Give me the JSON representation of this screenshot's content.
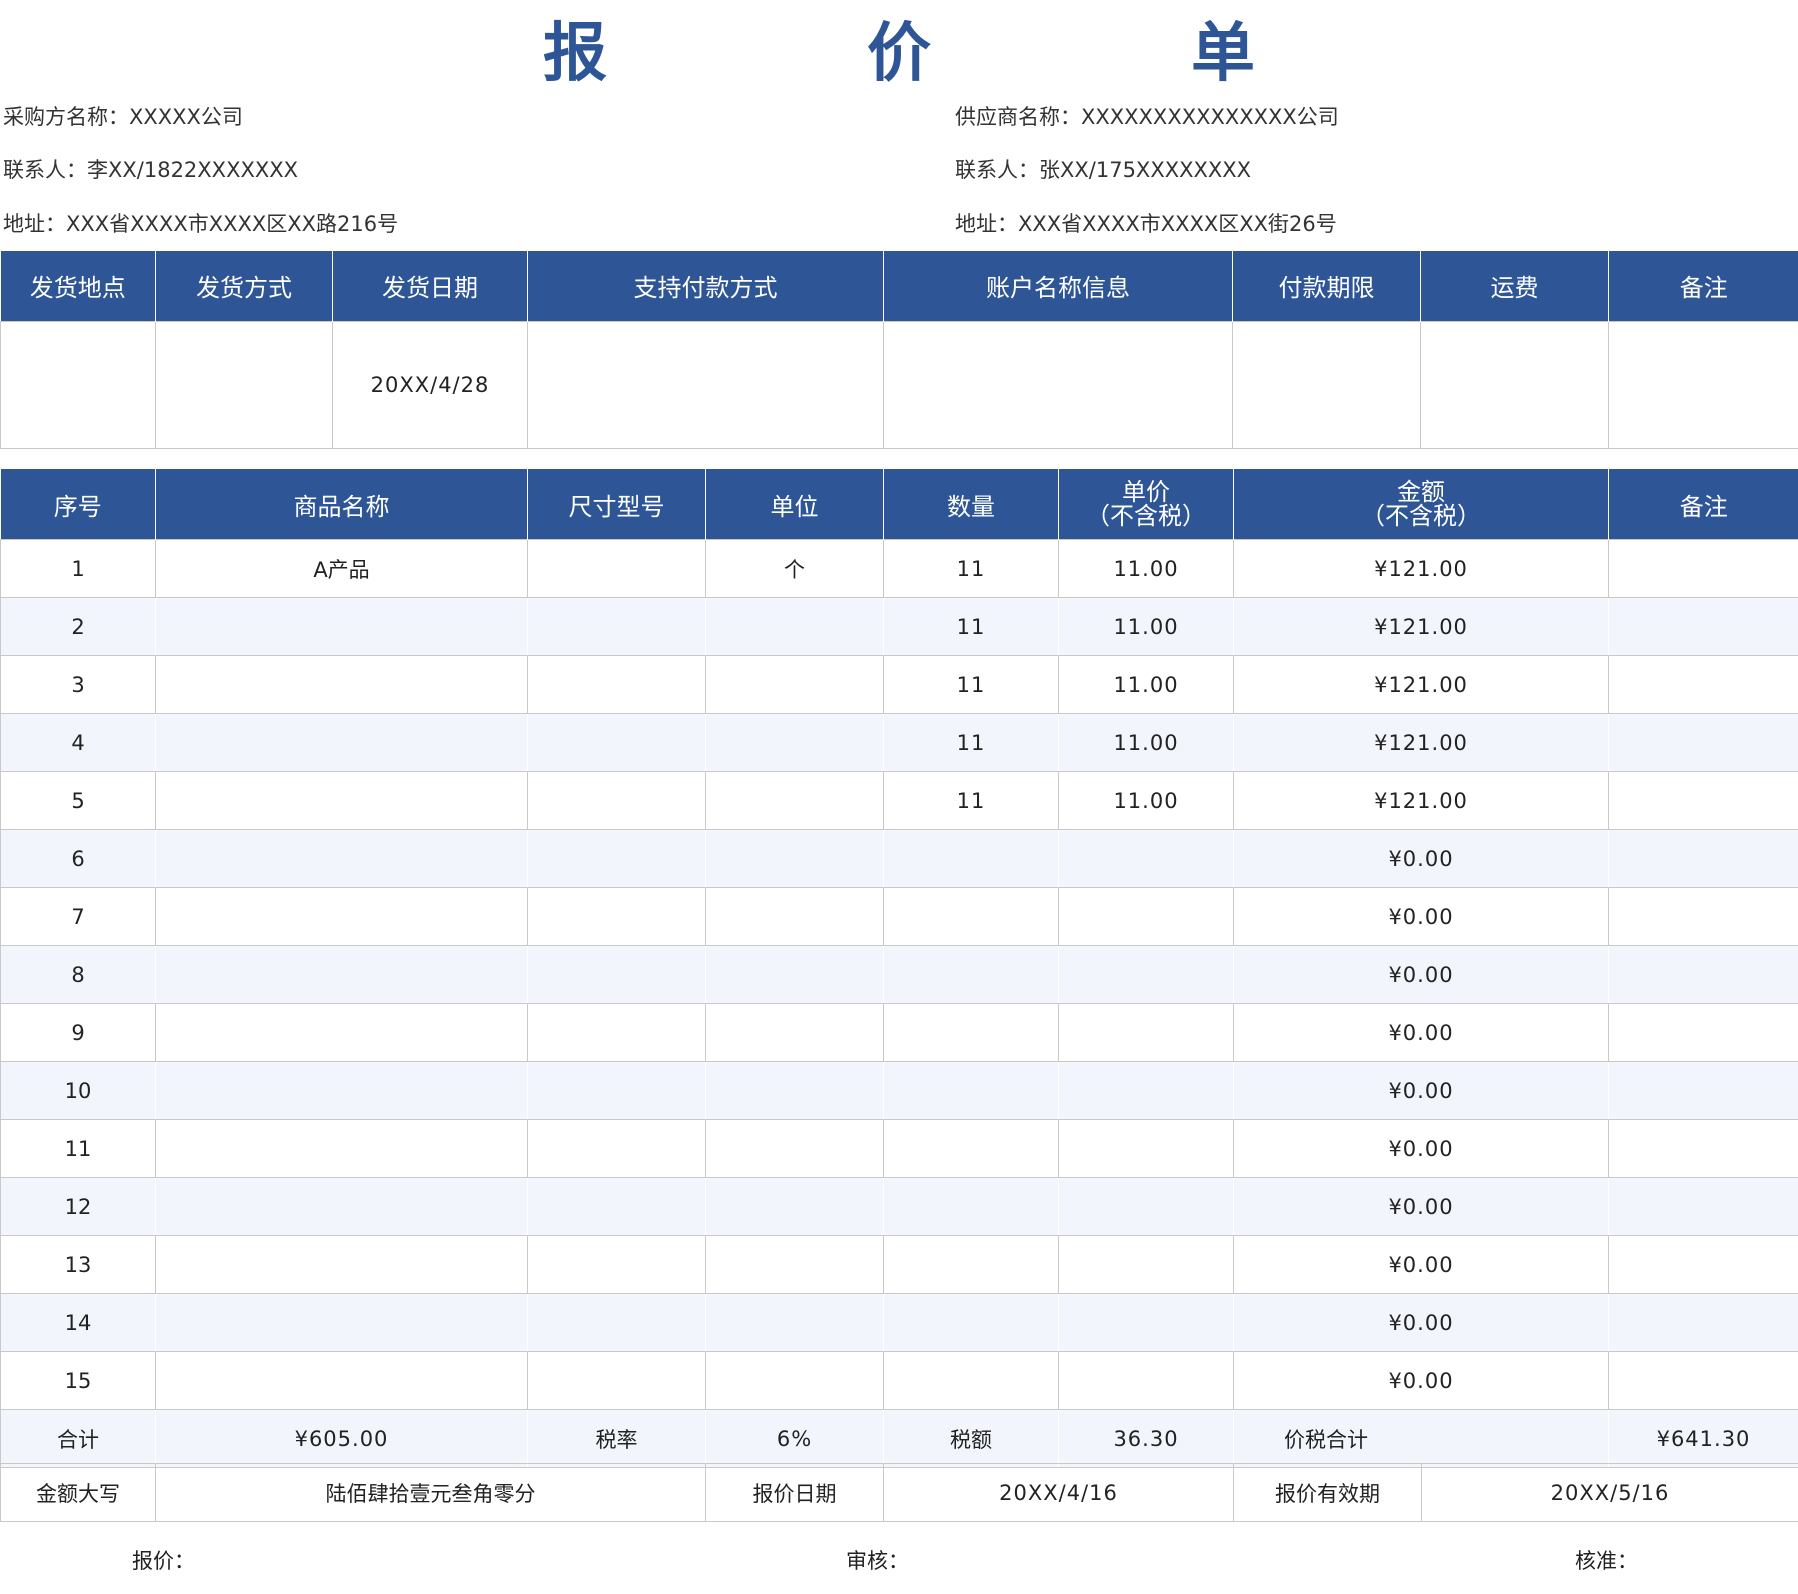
{
  "title": [
    "报",
    "价",
    "单"
  ],
  "buyer": {
    "name": "采购方名称：XXXXX公司",
    "contact": "联系人：李XX/1822XXXXXXX",
    "address": "地址：XXX省XXXX市XXXX区XX路216号"
  },
  "supplier": {
    "name": "供应商名称：XXXXXXXXXXXXXXX公司",
    "contact": "联系人：张XX/175XXXXXXXX",
    "address": "地址：XXX省XXXX市XXXX区XX街26号"
  },
  "shipping": {
    "headers": [
      "发货地点",
      "发货方式",
      "发货日期",
      "支持付款方式",
      "账户名称信息",
      "付款期限",
      "运费",
      "备注"
    ],
    "values": [
      "",
      "",
      "20XX/4/28",
      "",
      "",
      "",
      "",
      ""
    ]
  },
  "items": {
    "headers": [
      "序号",
      "商品名称",
      "尺寸型号",
      "单位",
      "数量",
      "单价\n（不含税）",
      "金额\n（不含税）",
      "备注"
    ],
    "header_unit_price": [
      "单价",
      "（不含税）"
    ],
    "header_amount": [
      "金额",
      "（不含税）"
    ],
    "rows": [
      {
        "no": "1",
        "name": "A产品",
        "size": "",
        "unit": "个",
        "qty": "11",
        "price": "11.00",
        "amount": "¥121.00",
        "note": ""
      },
      {
        "no": "2",
        "name": "",
        "size": "",
        "unit": "",
        "qty": "11",
        "price": "11.00",
        "amount": "¥121.00",
        "note": ""
      },
      {
        "no": "3",
        "name": "",
        "size": "",
        "unit": "",
        "qty": "11",
        "price": "11.00",
        "amount": "¥121.00",
        "note": ""
      },
      {
        "no": "4",
        "name": "",
        "size": "",
        "unit": "",
        "qty": "11",
        "price": "11.00",
        "amount": "¥121.00",
        "note": ""
      },
      {
        "no": "5",
        "name": "",
        "size": "",
        "unit": "",
        "qty": "11",
        "price": "11.00",
        "amount": "¥121.00",
        "note": ""
      },
      {
        "no": "6",
        "name": "",
        "size": "",
        "unit": "",
        "qty": "",
        "price": "",
        "amount": "¥0.00",
        "note": ""
      },
      {
        "no": "7",
        "name": "",
        "size": "",
        "unit": "",
        "qty": "",
        "price": "",
        "amount": "¥0.00",
        "note": ""
      },
      {
        "no": "8",
        "name": "",
        "size": "",
        "unit": "",
        "qty": "",
        "price": "",
        "amount": "¥0.00",
        "note": ""
      },
      {
        "no": "9",
        "name": "",
        "size": "",
        "unit": "",
        "qty": "",
        "price": "",
        "amount": "¥0.00",
        "note": ""
      },
      {
        "no": "10",
        "name": "",
        "size": "",
        "unit": "",
        "qty": "",
        "price": "",
        "amount": "¥0.00",
        "note": ""
      },
      {
        "no": "11",
        "name": "",
        "size": "",
        "unit": "",
        "qty": "",
        "price": "",
        "amount": "¥0.00",
        "note": ""
      },
      {
        "no": "12",
        "name": "",
        "size": "",
        "unit": "",
        "qty": "",
        "price": "",
        "amount": "¥0.00",
        "note": ""
      },
      {
        "no": "13",
        "name": "",
        "size": "",
        "unit": "",
        "qty": "",
        "price": "",
        "amount": "¥0.00",
        "note": ""
      },
      {
        "no": "14",
        "name": "",
        "size": "",
        "unit": "",
        "qty": "",
        "price": "",
        "amount": "¥0.00",
        "note": ""
      },
      {
        "no": "15",
        "name": "",
        "size": "",
        "unit": "",
        "qty": "",
        "price": "",
        "amount": "¥0.00",
        "note": ""
      }
    ]
  },
  "totals": {
    "subtotal_label": "合计",
    "subtotal_value": "¥605.00",
    "tax_rate_label": "税率",
    "tax_rate_value": "6%",
    "tax_amount_label": "税额",
    "tax_amount_value": "36.30",
    "grand_total_label": "价税合计",
    "grand_total_value": "¥641.30"
  },
  "summary": {
    "amount_words_label": "金额大写",
    "amount_words_value": "陆佰肆拾壹元叁角零分",
    "quote_date_label": "报价日期",
    "quote_date_value": "20XX/4/16",
    "validity_label": "报价有效期",
    "validity_value": "20XX/5/16"
  },
  "signatures": {
    "quoter": "报价：",
    "reviewer": "审核：",
    "approver": "核准："
  },
  "colors": {
    "header_bg": "#2e5596",
    "title": "#2e5596",
    "alt_row": "#f2f5fb"
  }
}
